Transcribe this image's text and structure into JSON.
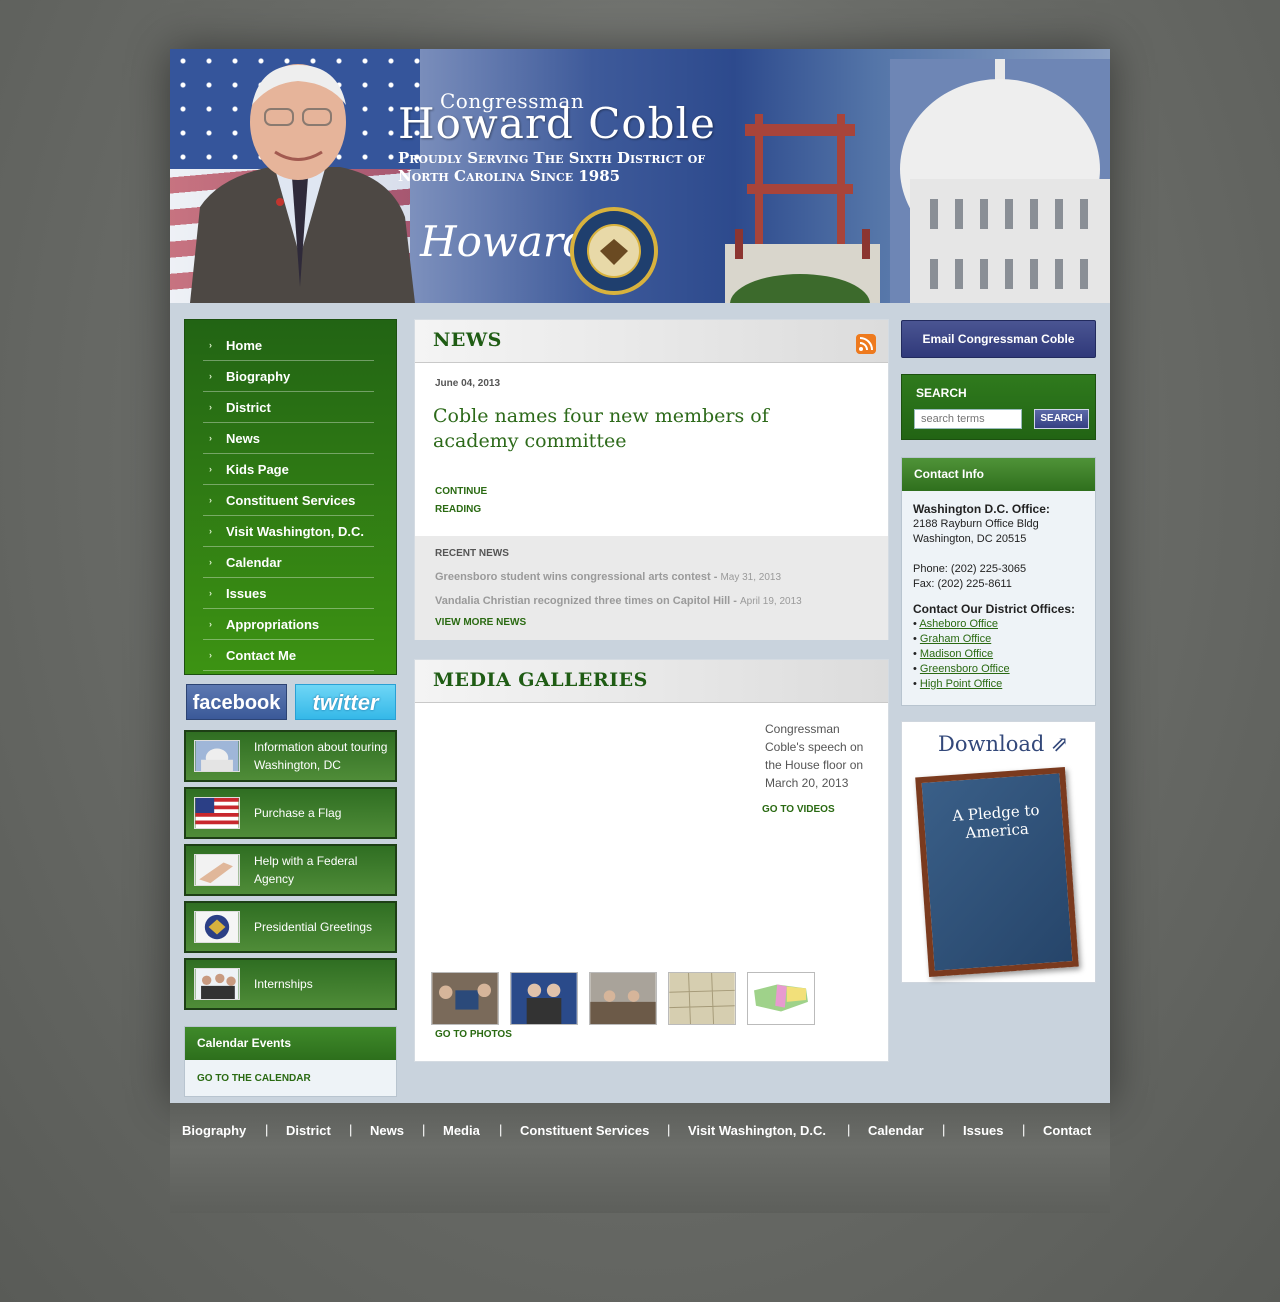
{
  "header": {
    "congressman": "Congressman",
    "name": "Howard Coble",
    "tagline": "Proudly Serving The Sixth District of North Carolina Since 1985",
    "signature": "Howard",
    "seal_text": "U.S. House of Representatives"
  },
  "nav": {
    "items": [
      {
        "label": "Home"
      },
      {
        "label": "Biography"
      },
      {
        "label": "District"
      },
      {
        "label": "News"
      },
      {
        "label": "Kids Page"
      },
      {
        "label": "Constituent Services"
      },
      {
        "label": "Visit Washington, D.C."
      },
      {
        "label": "Calendar"
      },
      {
        "label": "Issues"
      },
      {
        "label": "Appropriations"
      },
      {
        "label": "Contact Me"
      }
    ]
  },
  "social": {
    "facebook": "facebook",
    "twitter": "twitter"
  },
  "promos": [
    {
      "label": "Information about touring Washington, DC",
      "icon": "capitol-icon"
    },
    {
      "label": "Purchase a Flag",
      "icon": "flag-icon"
    },
    {
      "label": "Help with a Federal Agency",
      "icon": "handshake-icon"
    },
    {
      "label": "Presidential Greetings",
      "icon": "eagle-seal-icon"
    },
    {
      "label": "Internships",
      "icon": "people-icon"
    }
  ],
  "calendar": {
    "title": "Calendar Events",
    "link": "GO TO THE CALENDAR"
  },
  "news": {
    "title": "NEWS",
    "date": "June 04, 2013",
    "headline": "Coble names four new members of academy committee",
    "continue": "CONTINUE READING",
    "recent_title": "RECENT NEWS",
    "recent": [
      {
        "title": "Greensboro student wins congressional arts contest -",
        "date": "May 31, 2013"
      },
      {
        "title": "Vandalia Christian recognized three times on Capitol Hill -",
        "date": "April 19, 2013"
      }
    ],
    "view_more": "VIEW MORE NEWS"
  },
  "media": {
    "title": "MEDIA GALLERIES",
    "video_desc": "Congressman Coble's speech on the House floor on March 20, 2013",
    "go_videos": "GO TO VIDEOS",
    "go_photos": "GO TO PHOTOS"
  },
  "right": {
    "email_button": "Email Congressman Coble",
    "search_label": "SEARCH",
    "search_placeholder": "search terms",
    "search_button": "SEARCH",
    "contact_title": "Contact Info",
    "dc_office_label": "Washington D.C. Office:",
    "dc_address_1": "2188 Rayburn Office Bldg",
    "dc_address_2": "Washington, DC 20515",
    "phone": "Phone: (202) 225-3065",
    "fax": "Fax: (202) 225-8611",
    "district_label": "Contact Our District Offices:",
    "offices": [
      "Asheboro Office",
      "Graham Office",
      "Madison Office",
      "Greensboro Office",
      "High Point Office"
    ],
    "download_title": "Download",
    "book_title": "A Pledge to America"
  },
  "footer": {
    "items": [
      "Biography",
      "District",
      "News",
      "Media",
      "Constituent Services",
      "Visit Washington, D.C.",
      "Calendar",
      "Issues",
      "Contact"
    ]
  },
  "colors": {
    "nav_green": "#3d9313",
    "link_green": "#2a6a12",
    "email_blue": "#30397a"
  }
}
